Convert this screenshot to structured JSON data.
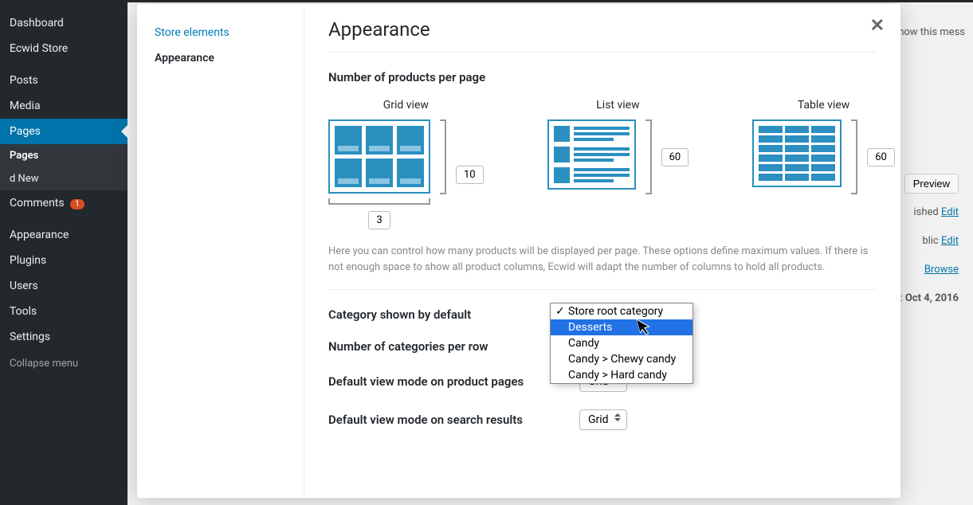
{
  "wp_sidebar": {
    "items": [
      {
        "label": "Dashboard"
      },
      {
        "label": "Ecwid Store"
      },
      {
        "label": "Posts"
      },
      {
        "label": "Media"
      },
      {
        "label": "Pages"
      },
      {
        "label": "Comments"
      },
      {
        "label": "Appearance"
      },
      {
        "label": "Plugins"
      },
      {
        "label": "Users"
      },
      {
        "label": "Tools"
      },
      {
        "label": "Settings"
      }
    ],
    "comments_badge": "1",
    "subitems": {
      "pages": "Pages",
      "add_new": "d New"
    },
    "collapse": "Collapse menu"
  },
  "bg": {
    "show_msg": "show this mess",
    "preview": "Preview",
    "status_label": "ished",
    "visibility_label": "blic",
    "edit": "Edit",
    "browse": "Browse",
    "date_label": "n:",
    "date_value": "Oct 4, 2016"
  },
  "modal": {
    "sidebar": [
      {
        "label": "Store elements",
        "active": false
      },
      {
        "label": "Appearance",
        "active": true
      }
    ],
    "title": "Appearance",
    "products_per_page": {
      "heading": "Number of products per page",
      "grid_label": "Grid view",
      "list_label": "List view",
      "table_label": "Table view",
      "grid_rows": "10",
      "grid_cols": "3",
      "list_rows": "60",
      "table_rows": "60",
      "help": "Here you can control how many products will be displayed per page. These options define maximum values. If there is not enough space to show all product columns, Ecwid will adapt the number of columns to hold all products."
    },
    "category_default": {
      "label": "Category shown by default",
      "options": [
        {
          "label": "Store root category",
          "checked": true,
          "hl": false
        },
        {
          "label": "Desserts",
          "checked": false,
          "hl": true
        },
        {
          "label": "Candy",
          "checked": false,
          "hl": false
        },
        {
          "label": "Candy > Chewy candy",
          "checked": false,
          "hl": false
        },
        {
          "label": "Candy > Hard candy",
          "checked": false,
          "hl": false
        }
      ]
    },
    "categories_per_row": {
      "label": "Number of categories per row"
    },
    "view_mode_product": {
      "label": "Default view mode on product pages",
      "value": "Grid"
    },
    "view_mode_search": {
      "label": "Default view mode on search results",
      "value": "Grid"
    }
  }
}
